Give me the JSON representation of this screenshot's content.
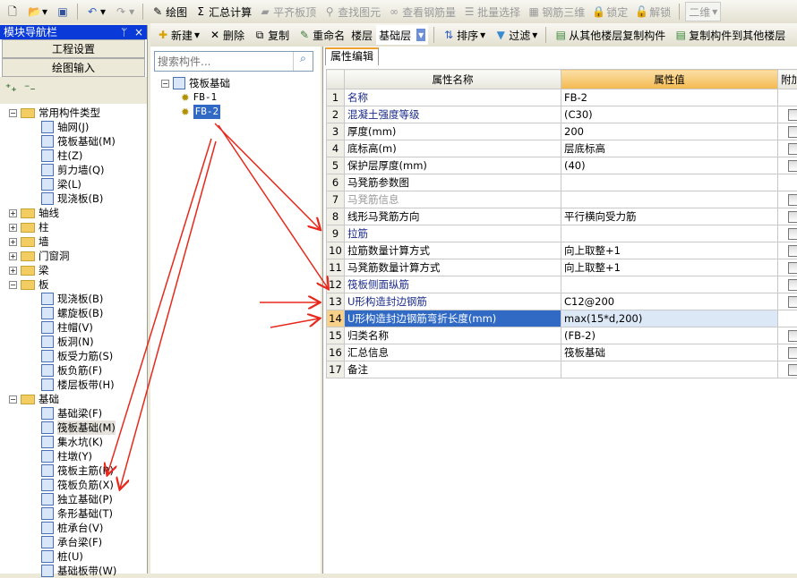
{
  "toolbar1": {
    "items": [
      {
        "label": "绘图",
        "icon": "draw-icon"
      },
      {
        "label": "汇总计算",
        "icon": "sigma-icon"
      },
      {
        "label": "平齐板顶",
        "icon": "align-icon",
        "disabled": true
      },
      {
        "label": "查找图元",
        "icon": "binoculars-icon",
        "disabled": true
      },
      {
        "label": "查看钢筋量",
        "icon": "view-icon",
        "disabled": true
      },
      {
        "label": "批量选择",
        "icon": "batch-icon",
        "disabled": true
      },
      {
        "label": "钢筋三维",
        "icon": "3d-icon",
        "disabled": true
      },
      {
        "label": "锁定",
        "icon": "lock-icon",
        "disabled": true
      },
      {
        "label": "解锁",
        "icon": "unlock-icon",
        "disabled": true
      }
    ],
    "view_select": "二维"
  },
  "toolbar2": {
    "new": "新建",
    "delete": "删除",
    "copy": "复制",
    "rename": "重命名",
    "floor_label": "楼层",
    "floor_value": "基础层",
    "sort": "排序",
    "filter": "过滤",
    "copy_from": "从其他楼层复制构件",
    "copy_to": "复制构件到其他楼层"
  },
  "left_panel": {
    "title": "模块导航栏",
    "pin": "ᛘ",
    "close": "×",
    "buttons": [
      "工程设置",
      "绘图输入"
    ],
    "tree": [
      {
        "label": "常用构件类型",
        "level": 0,
        "type": "folder",
        "open": true
      },
      {
        "label": "轴网(J)",
        "level": 1
      },
      {
        "label": "筏板基础(M)",
        "level": 1
      },
      {
        "label": "柱(Z)",
        "level": 1
      },
      {
        "label": "剪力墙(Q)",
        "level": 1
      },
      {
        "label": "梁(L)",
        "level": 1
      },
      {
        "label": "现浇板(B)",
        "level": 1
      },
      {
        "label": "轴线",
        "level": 0,
        "type": "folder"
      },
      {
        "label": "柱",
        "level": 0,
        "type": "folder"
      },
      {
        "label": "墙",
        "level": 0,
        "type": "folder"
      },
      {
        "label": "门窗洞",
        "level": 0,
        "type": "folder"
      },
      {
        "label": "梁",
        "level": 0,
        "type": "folder"
      },
      {
        "label": "板",
        "level": 0,
        "type": "folder",
        "open": true
      },
      {
        "label": "现浇板(B)",
        "level": 1
      },
      {
        "label": "螺旋板(B)",
        "level": 1
      },
      {
        "label": "柱帽(V)",
        "level": 1
      },
      {
        "label": "板洞(N)",
        "level": 1
      },
      {
        "label": "板受力筋(S)",
        "level": 1
      },
      {
        "label": "板负筋(F)",
        "level": 1
      },
      {
        "label": "楼层板带(H)",
        "level": 1
      },
      {
        "label": "基础",
        "level": 0,
        "type": "folder",
        "open": true
      },
      {
        "label": "基础梁(F)",
        "level": 1
      },
      {
        "label": "筏板基础(M)",
        "level": 1,
        "selected": true
      },
      {
        "label": "集水坑(K)",
        "level": 1
      },
      {
        "label": "柱墩(Y)",
        "level": 1
      },
      {
        "label": "筏板主筋(R)",
        "level": 1
      },
      {
        "label": "筏板负筋(X)",
        "level": 1
      },
      {
        "label": "独立基础(P)",
        "level": 1
      },
      {
        "label": "条形基础(T)",
        "level": 1
      },
      {
        "label": "桩承台(V)",
        "level": 1
      },
      {
        "label": "承台梁(F)",
        "level": 1
      },
      {
        "label": "桩(U)",
        "level": 1
      },
      {
        "label": "基础板带(W)",
        "level": 1
      }
    ]
  },
  "component_panel": {
    "search_placeholder": "搜索构件...",
    "root": "筏板基础",
    "items": [
      {
        "label": "FB-1"
      },
      {
        "label": "FB-2",
        "selected": true
      }
    ]
  },
  "property_panel": {
    "tab": "属性编辑",
    "headers": [
      "属性名称",
      "属性值",
      "附加"
    ],
    "rows": [
      {
        "n": "1",
        "name": "名称",
        "value": "FB-2",
        "style": "blue",
        "cb": false
      },
      {
        "n": "2",
        "name": "混凝土强度等级",
        "value": "(C30)",
        "style": "blue",
        "cb": true
      },
      {
        "n": "3",
        "name": "厚度(mm)",
        "value": "200",
        "cb": true
      },
      {
        "n": "4",
        "name": "底标高(m)",
        "value": "层底标高",
        "cb": true
      },
      {
        "n": "5",
        "name": "保护层厚度(mm)",
        "value": "(40)",
        "cb": true
      },
      {
        "n": "6",
        "name": "马凳筋参数图",
        "value": "",
        "cb": false
      },
      {
        "n": "7",
        "name": "马凳筋信息",
        "value": "",
        "style": "gray",
        "cb": true
      },
      {
        "n": "8",
        "name": "线形马凳筋方向",
        "value": "平行横向受力筋",
        "cb": true
      },
      {
        "n": "9",
        "name": "拉筋",
        "value": "",
        "style": "blue",
        "cb": true
      },
      {
        "n": "10",
        "name": "拉筋数量计算方式",
        "value": "向上取整+1",
        "cb": true
      },
      {
        "n": "11",
        "name": "马凳筋数量计算方式",
        "value": "向上取整+1",
        "cb": true
      },
      {
        "n": "12",
        "name": "筏板侧面纵筋",
        "value": "",
        "style": "blue",
        "cb": true
      },
      {
        "n": "13",
        "name": "U形构造封边钢筋",
        "value": "C12@200",
        "style": "blue",
        "cb": true
      },
      {
        "n": "14",
        "name": "U形构造封边钢筋弯折长度(mm)",
        "value": "max(15*d,200)",
        "selected": true,
        "cb": false
      },
      {
        "n": "15",
        "name": "归类名称",
        "value": "(FB-2)",
        "cb": true
      },
      {
        "n": "16",
        "name": "汇总信息",
        "value": "筏板基础",
        "cb": true
      },
      {
        "n": "17",
        "name": "备注",
        "value": "",
        "cb": true
      }
    ]
  },
  "colors": {
    "title_bar": "#0a3ad8",
    "selection": "#316ac5",
    "annotation": "#e8281c"
  }
}
